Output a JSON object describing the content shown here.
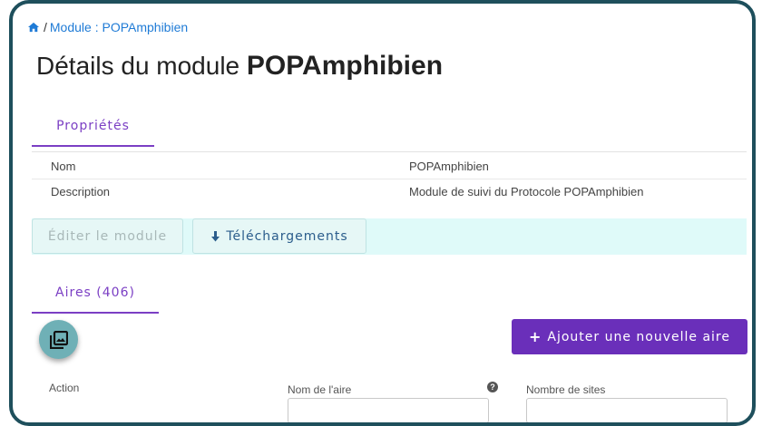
{
  "breadcrumb": {
    "separator": "/",
    "current": "Module : POPAmphibien"
  },
  "title": {
    "prefix": "Détails du module ",
    "module_name": "POPAmphibien"
  },
  "tabs": [
    {
      "label": "Propriétés"
    }
  ],
  "properties": [
    {
      "label": "Nom",
      "value": "POPAmphibien"
    },
    {
      "label": "Description",
      "value": "Module de suivi du Protocole POPAmphibien"
    }
  ],
  "actions": {
    "edit_label": "Éditer le module",
    "download_label": "Téléchargements"
  },
  "section_tabs": [
    {
      "label": "Aires (406)"
    }
  ],
  "add_button": {
    "label": "Ajouter une nouvelle aire"
  },
  "table": {
    "columns": [
      "Action",
      "Nom de l'aire",
      "Nombre de sites"
    ],
    "filters": {
      "name": "",
      "sites": ""
    }
  },
  "colors": {
    "accent": "#6a2fba",
    "link": "#1f7bd6",
    "frame": "#1e4f5c",
    "action_bar": "#dffaf9"
  }
}
